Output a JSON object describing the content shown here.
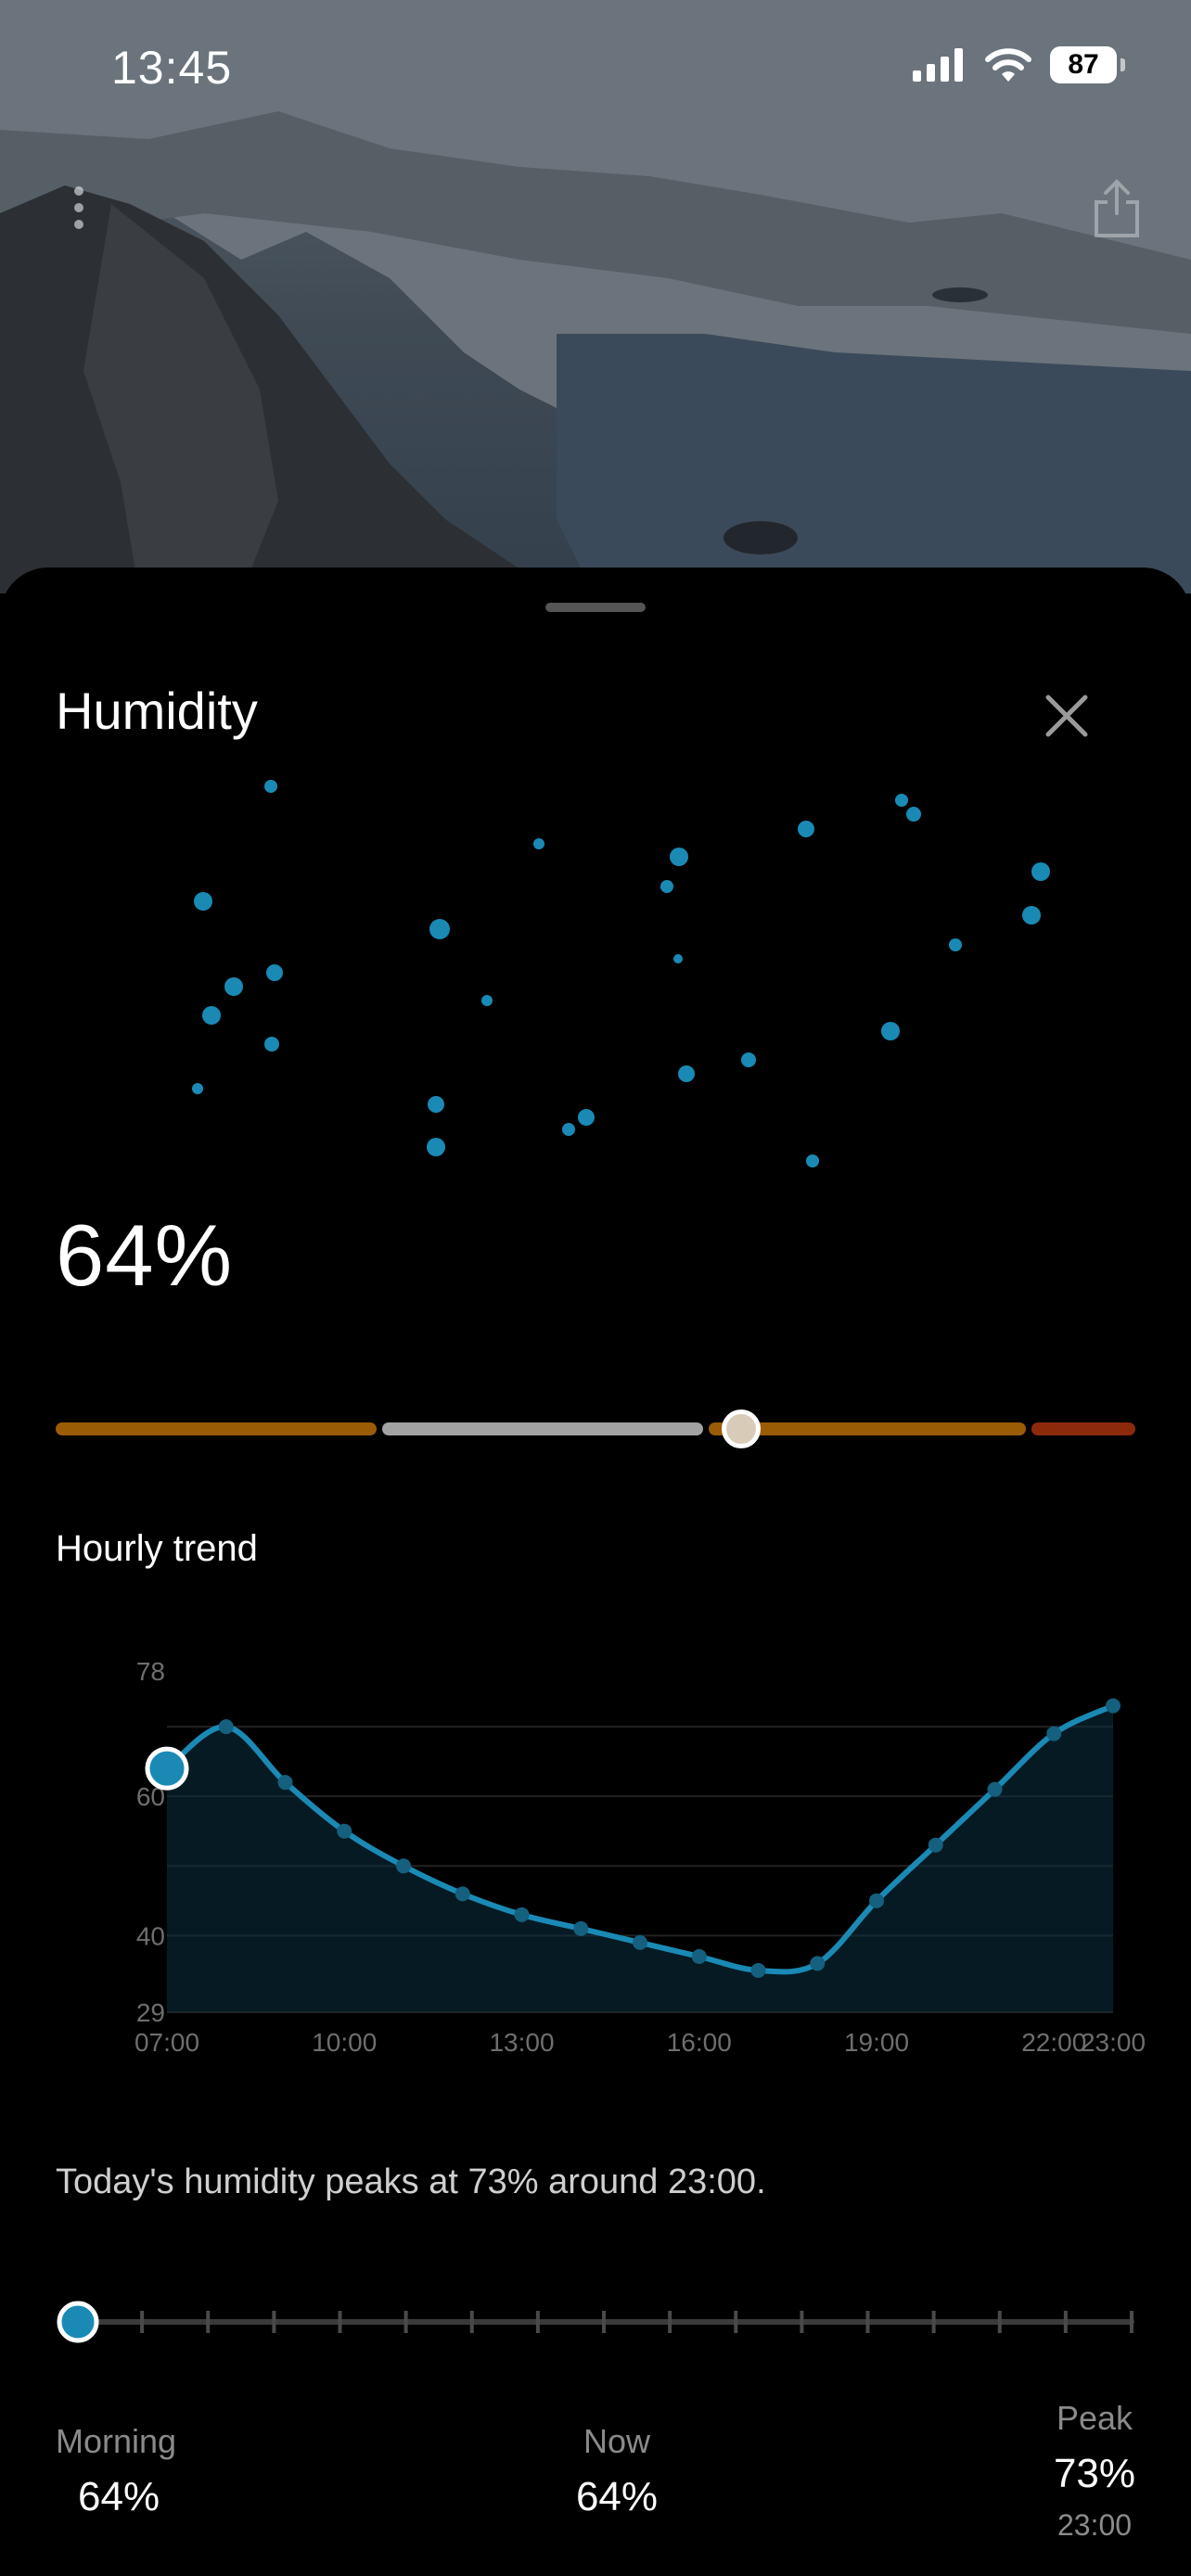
{
  "status_bar": {
    "time": "13:45",
    "battery": "87"
  },
  "sheet": {
    "title": "Humidity"
  },
  "current": {
    "value": "64%",
    "scale_position": 0.64
  },
  "trend": {
    "title": "Hourly trend"
  },
  "chart_data": {
    "type": "line",
    "x_ticks": [
      "07:00",
      "10:00",
      "13:00",
      "16:00",
      "19:00",
      "22:00",
      "23:00"
    ],
    "y_ticks": [
      "78",
      "60",
      "40",
      "29"
    ],
    "ylim": [
      29,
      78
    ],
    "series": [
      {
        "values": [
          [
            7,
            64
          ],
          [
            8,
            70
          ],
          [
            9,
            62
          ],
          [
            10,
            55
          ],
          [
            11,
            50
          ],
          [
            12,
            46
          ],
          [
            13,
            43
          ],
          [
            14,
            41
          ],
          [
            15,
            39
          ],
          [
            16,
            37
          ],
          [
            17,
            35
          ],
          [
            18,
            36
          ],
          [
            19,
            45
          ],
          [
            20,
            53
          ],
          [
            21,
            61
          ],
          [
            22,
            69
          ],
          [
            23,
            73
          ]
        ]
      }
    ],
    "current_point": [
      7,
      64
    ]
  },
  "summary": "Today's humidity peaks at 73% around 23:00.",
  "stats": {
    "morning_label": "Morning",
    "morning_value": "64%",
    "now_label": "Now",
    "now_value": "64%",
    "peak_label": "Peak",
    "peak_value": "73%",
    "peak_time": "23:00"
  },
  "colors": {
    "accent": "#1a8ab5",
    "dry": "#9a5c05",
    "normal": "#a3a3a3",
    "humid": "#9a5c05",
    "very_humid": "#8e2a0c"
  }
}
